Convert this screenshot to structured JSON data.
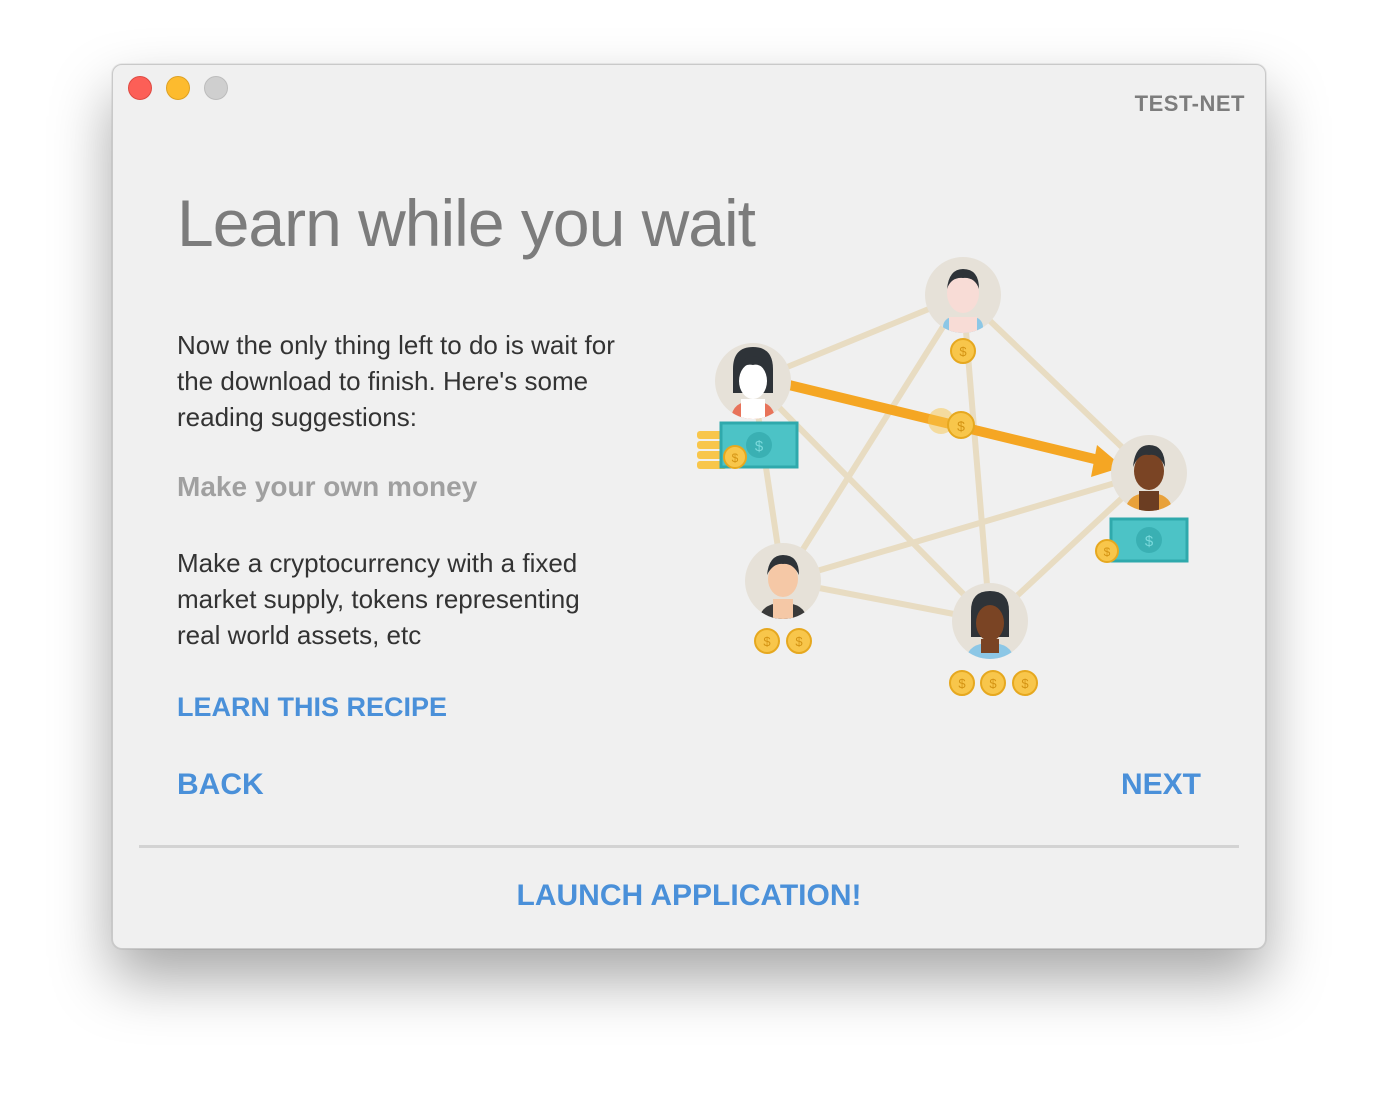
{
  "window": {
    "network_label": "TEST-NET"
  },
  "main": {
    "title": "Learn while you wait",
    "intro": "Now the only thing left to do is wait for the download to finish. Here's some reading suggestions:",
    "recipe": {
      "title": "Make your own money",
      "description": "Make a cryptocurrency with a fixed market supply, tokens representing real world assets, etc",
      "link_label": "LEARN THIS RECIPE"
    }
  },
  "navigation": {
    "back_label": "BACK",
    "next_label": "NEXT"
  },
  "footer": {
    "launch_label": "LAUNCH APPLICATION!"
  },
  "illustration": {
    "currency_symbol": "$"
  },
  "colors": {
    "link": "#4a90d9",
    "arrow": "#f5a623",
    "network_line": "#e8dcc2",
    "coin": "#f8c64b",
    "bill": "#4cc3c6"
  }
}
